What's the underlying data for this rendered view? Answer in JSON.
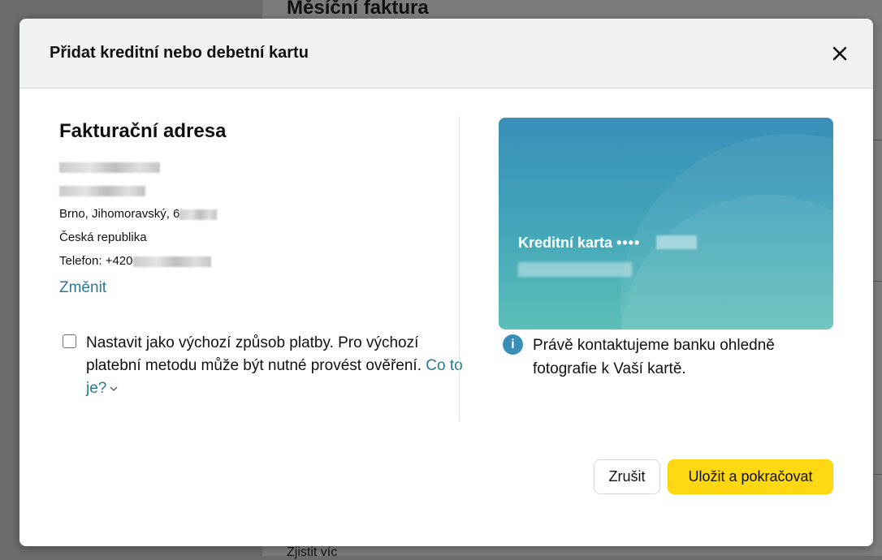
{
  "background": {
    "page_title": "Měsíční faktura",
    "bottom_text": "Zjistit víc"
  },
  "modal": {
    "title": "Přidat kreditní nebo debetní kartu",
    "close_icon": "close-icon"
  },
  "billing": {
    "heading": "Fakturační adresa",
    "city_line": "Brno, Jihomoravský, 6",
    "country": "Česká republika",
    "phone_prefix": "Telefon: +420",
    "change_link": "Změnit"
  },
  "default_payment": {
    "text": "Nastavit jako výchozí způsob platby. Pro výchozí platební metodu může být nutné provést ověření.",
    "what_is_link": "Co to je?",
    "checked": false
  },
  "card": {
    "label": "Kreditní karta",
    "dots": "••••",
    "colors": {
      "top": "#3a8fb8",
      "bottom": "#5dbfb8"
    }
  },
  "info": {
    "icon": "info-icon",
    "text": "Právě kontaktujeme banku ohledně fotografie k Vaší kartě."
  },
  "buttons": {
    "cancel": "Zrušit",
    "save": "Uložit a pokračovat"
  },
  "colors": {
    "accent_link": "#2a7a8c",
    "primary_button": "#ffd814"
  }
}
